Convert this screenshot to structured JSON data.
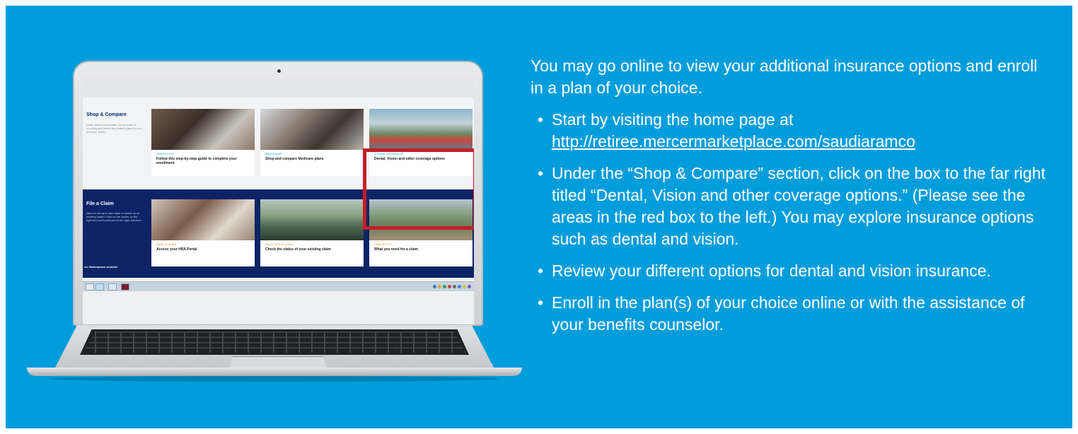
{
  "laptop_screen": {
    "shop_compare": {
      "title": "Shop & Compare",
      "description": "Learn about the benefits, the process of enrolling and select the perfect plans for you and your family.",
      "cards": [
        {
          "kicker": "CHECKLIST",
          "title": "Follow this step-by-step guide to complete your enrollment"
        },
        {
          "kicker": "MEDICARE",
          "title": "Shop and compare Medicare plans"
        },
        {
          "kicker": "OTHER COVERAGE",
          "title": "Dental, Vision and other coverage options"
        }
      ]
    },
    "file_claim": {
      "title": "File a Claim",
      "description": "Need to set up a new claim or check on an existing claim? Click on the option on the right and we'll point you in the right direction.",
      "cards": [
        {
          "kicker": "NEW CLAIMS",
          "title": "Access your HRA Portal"
        },
        {
          "kicker": "EXISTING CLAIMS",
          "title": "Check the status of your existing claim"
        },
        {
          "kicker": "CHECKLIST",
          "title": "What you need for a claim"
        }
      ],
      "footnote": "cer Marketplace website!"
    },
    "highlight_color": "#c41e26"
  },
  "instructions": {
    "intro": "You may go online to view your additional insurance options and enroll in a plan of your choice.",
    "bullet_symbol": "•",
    "bullet1_text": "Start by visiting the home page at",
    "bullet1_link": "http://retiree.mercermarketplace.com/saudiaramco",
    "bullet2": "Under the “Shop & Compare” section, click on the box to the far right titled “Dental, Vision and other coverage options.” (Please see the areas in the red box to the left.) You may explore insurance options such as dental and vision.",
    "bullet3": "Review your different options for dental and vision insurance.",
    "bullet4": "Enroll in the plan(s) of your choice online or with the assistance of your benefits counselor."
  },
  "colors": {
    "background": "#009ddc",
    "navy": "#0c2466",
    "accent_blue": "#2eb4e6"
  }
}
